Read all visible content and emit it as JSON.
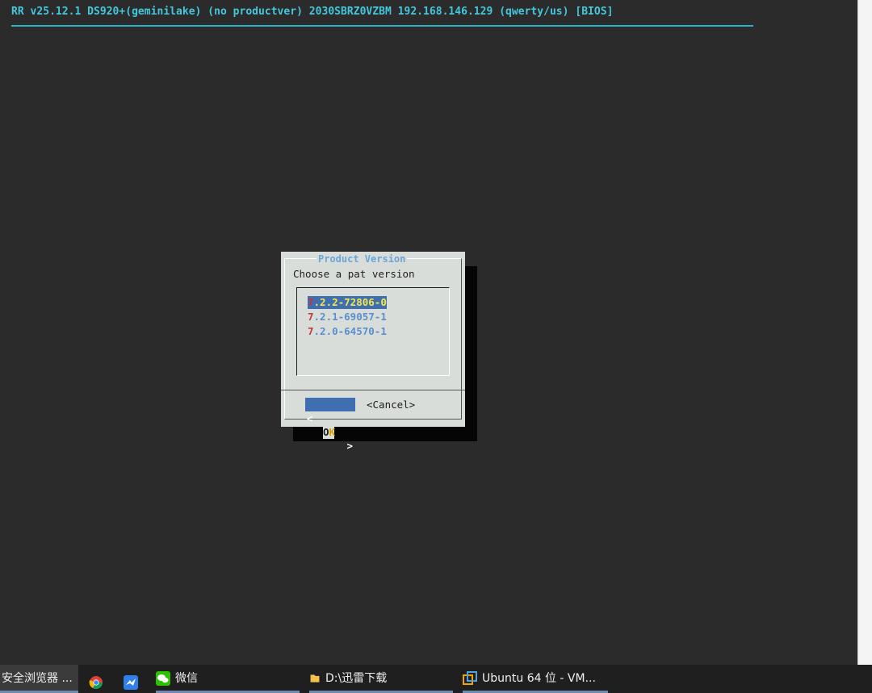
{
  "header": {
    "text": "RR v25.12.1 DS920+(geminilake) (no productver) 2030SBRZ0VZBM 192.168.146.129 (qwerty/us) [BIOS]"
  },
  "dialog": {
    "title": "Product Version",
    "prompt": "Choose a pat version",
    "items": [
      {
        "hot": "7",
        "rest": ".2.2-72806-0",
        "selected": true
      },
      {
        "hot": "7",
        "rest": ".2.1-69057-1",
        "selected": false
      },
      {
        "hot": "7",
        "rest": ".2.0-64570-1",
        "selected": false
      }
    ],
    "ok_left": "<",
    "ok_label_first": "O",
    "ok_label_second": "K",
    "ok_right": ">",
    "cancel_label": "<Cancel>"
  },
  "taskbar": {
    "browser_label": "安全浏览器 ...",
    "chrome_icon": "chrome-icon",
    "bird_icon": "bird-app-icon",
    "wechat_label": "微信",
    "folder_label": "D:\\迅雷下载",
    "vm_label": "Ubuntu 64 位 - VM..."
  },
  "colors": {
    "console_bg": "#2b2b2b",
    "header_cyan": "#45c8dc",
    "dialog_bg": "#d9ddd9",
    "selection_blue": "#3f6fb0",
    "hotkey_red": "#c03a3a"
  }
}
